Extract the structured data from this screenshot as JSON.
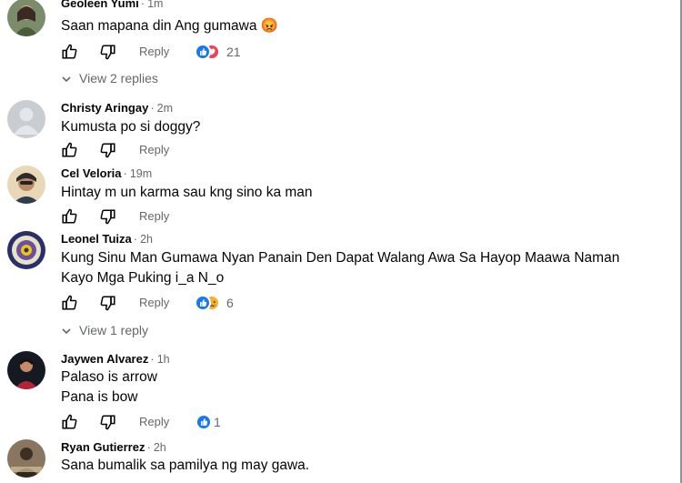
{
  "ui": {
    "reply_label": "Reply",
    "dot": "·"
  },
  "comments": [
    {
      "name": "Geoleen Yumi",
      "time": "1m",
      "lines": [
        "Saan mapana din Ang gumawa 😡"
      ],
      "reactions_count": "21",
      "reactions": [
        "like",
        "love"
      ],
      "view_replies": "View 2 replies"
    },
    {
      "name": "Christy Aringay",
      "time": "2m",
      "lines": [
        "Kumusta po si doggy?"
      ]
    },
    {
      "name": "Cel Veloria",
      "time": "19m",
      "lines": [
        "Hintay m un karma sau kng sino ka man"
      ]
    },
    {
      "name": "Leonel Tuiza",
      "time": "2h",
      "lines": [
        "Kung Sinu Man Gumawa Nyan Panain Den Dapat Walang Awa Sa Hayop Maawa Naman",
        "Kayo Mga Puking i_a N_o"
      ],
      "reactions_count": "6",
      "reactions": [
        "like",
        "sad"
      ],
      "view_replies": "View 1 reply"
    },
    {
      "name": "Jaywen Alvarez",
      "time": "1h",
      "lines": [
        "Palaso is arrow",
        "Pana is bow"
      ],
      "reactions_count": "1",
      "reactions": [
        "like"
      ]
    },
    {
      "name": "Ryan Gutierrez",
      "time": "2h",
      "lines": [
        "Sana bumalik sa pamilya ng may gawa."
      ]
    }
  ],
  "colors": {
    "like_blue": "#1877f2",
    "love_red": "#f33e58",
    "sad_yellow": "#f7b125",
    "secondary_text": "#65676b"
  }
}
